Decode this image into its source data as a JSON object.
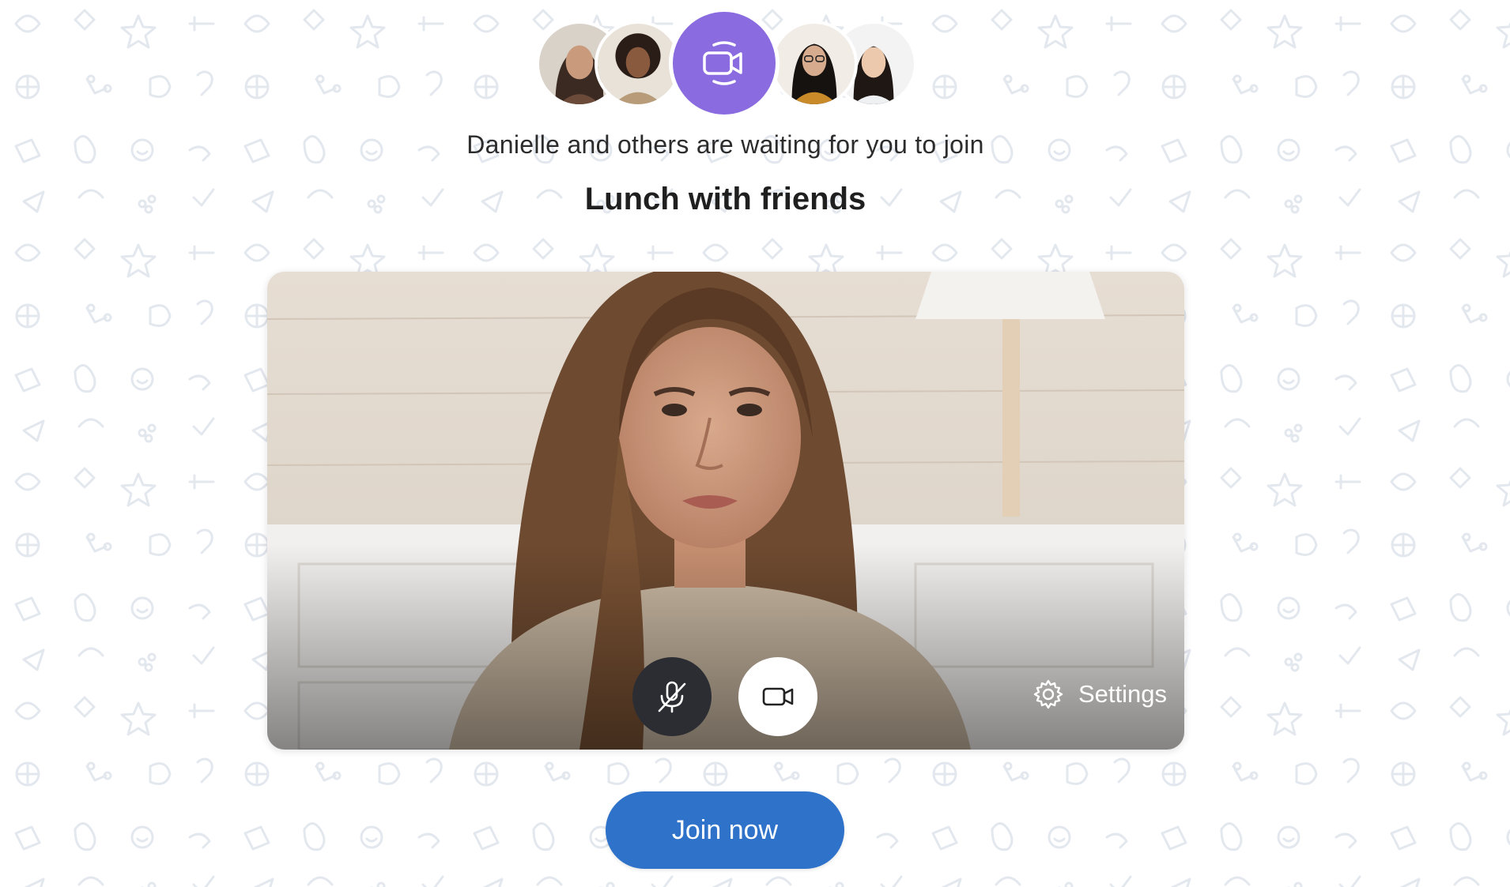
{
  "invite": {
    "waiting_text": "Danielle and others are waiting for you to join",
    "meeting_title": "Lunch with friends"
  },
  "participants": [
    {
      "name": "participant-1"
    },
    {
      "name": "participant-2"
    },
    {
      "name": "participant-3"
    },
    {
      "name": "participant-4"
    }
  ],
  "controls": {
    "mic_icon": "microphone-muted-icon",
    "camera_icon": "video-camera-icon",
    "settings_icon": "gear-icon",
    "settings_label": "Settings"
  },
  "join_label": "Join now",
  "colors": {
    "accent_purple": "#8a6be0",
    "join_blue": "#2f72c9",
    "mic_dark": "#2b2d33"
  }
}
